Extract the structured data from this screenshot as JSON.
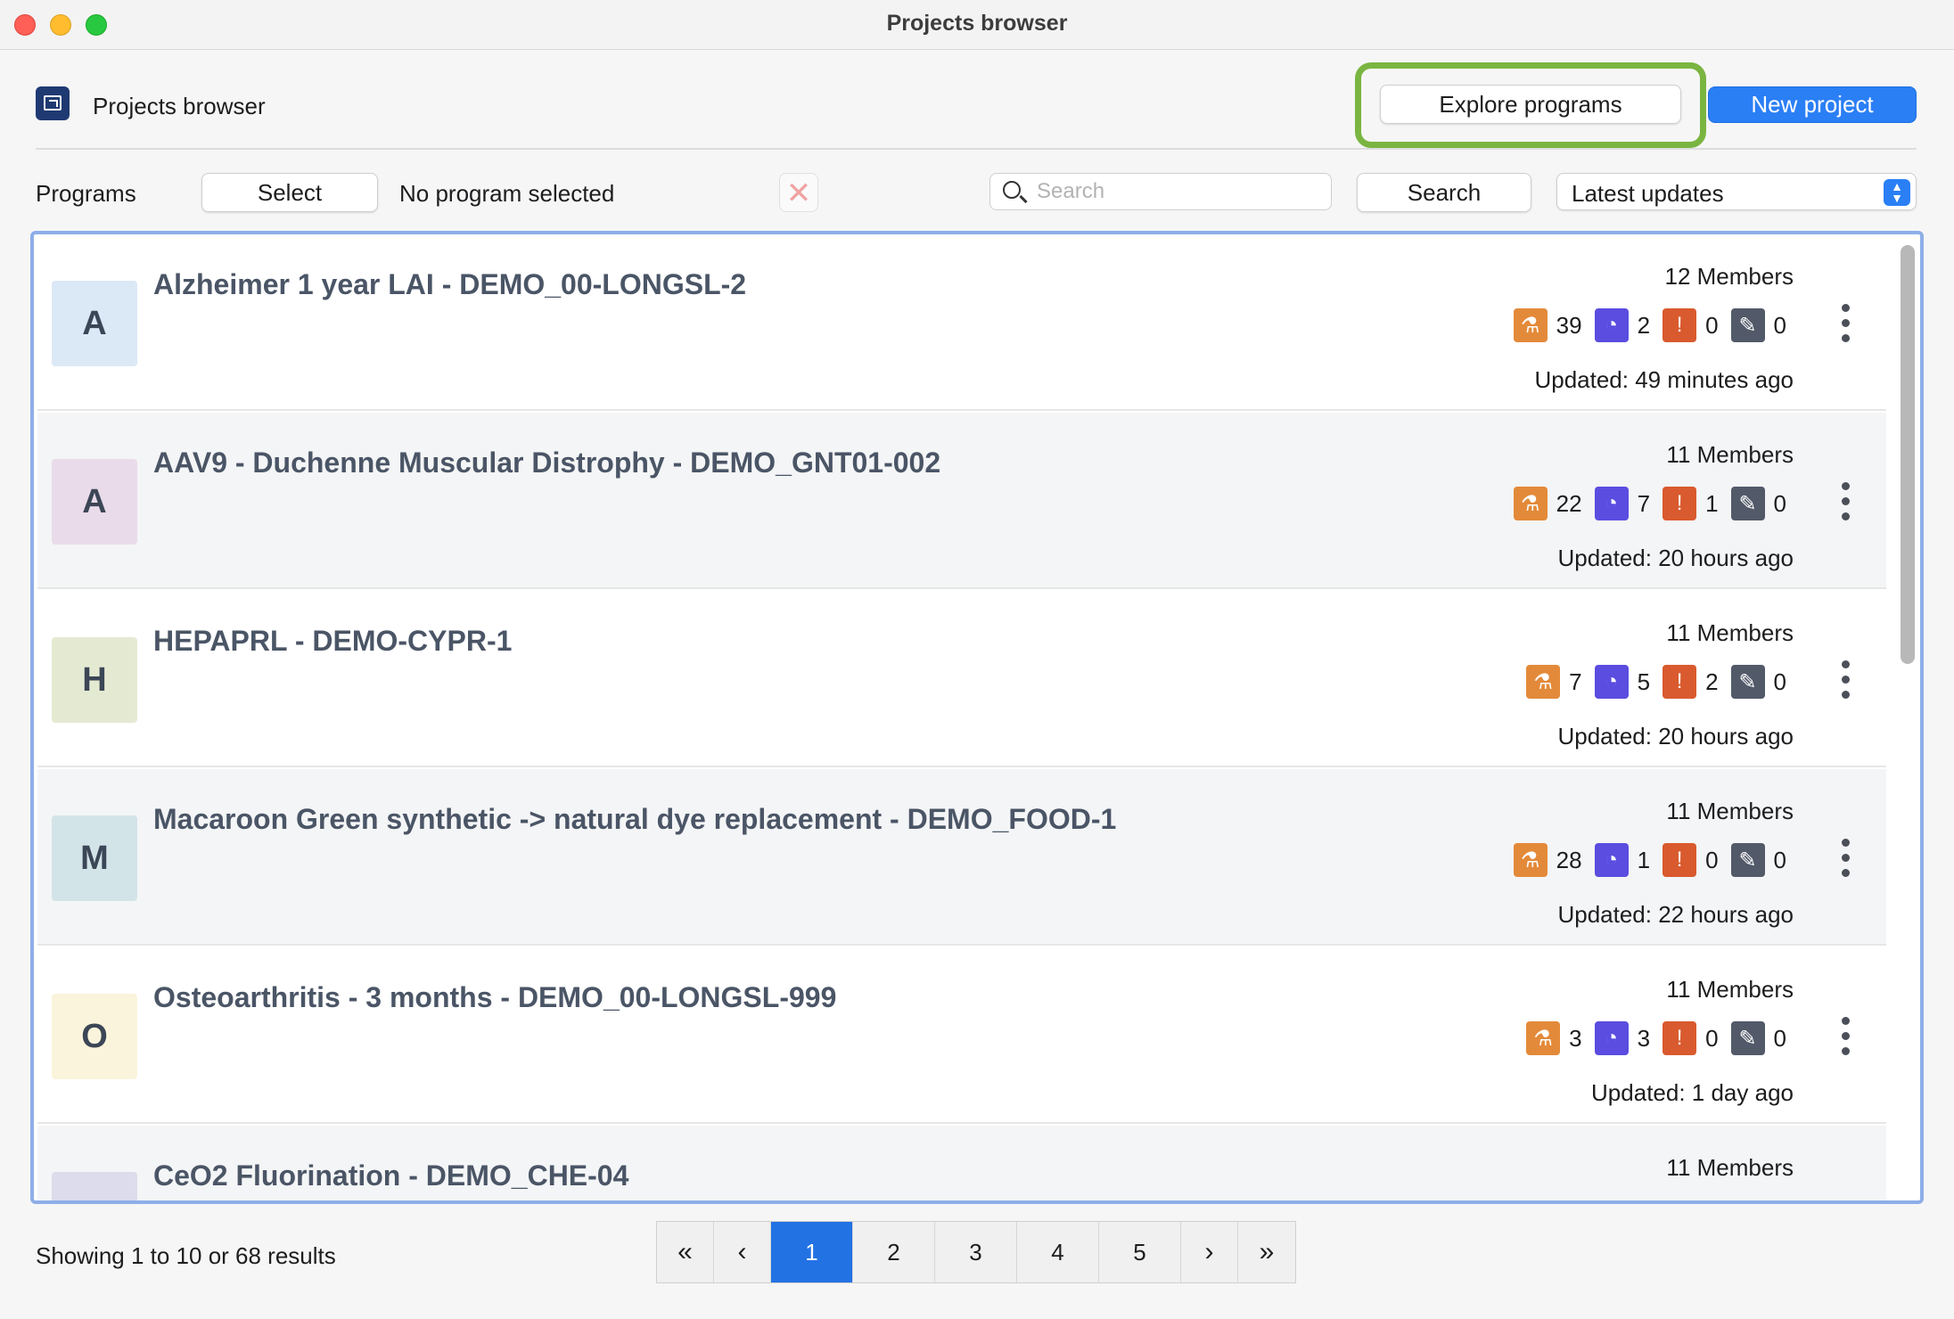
{
  "window": {
    "title": "Projects browser"
  },
  "header": {
    "title": "Projects browser",
    "explore_label": "Explore programs",
    "new_label": "New project"
  },
  "filters": {
    "programs_label": "Programs",
    "select_label": "Select",
    "no_program": "No program selected",
    "clear_icon": "✕",
    "search_placeholder": "Search",
    "search_label": "Search",
    "sort_value": "Latest updates"
  },
  "projects": [
    {
      "initial": "A",
      "avatar_color": "#dbe8f6",
      "title": "Alzheimer 1 year LAI - DEMO_00-LONGSL-2",
      "members": "12 Members",
      "lab": "39",
      "pie": "2",
      "warn": "0",
      "doc": "0",
      "updated": "Updated: 49 minutes ago"
    },
    {
      "initial": "A",
      "avatar_color": "#eadbea",
      "title": "AAV9 - Duchenne Muscular Distrophy - DEMO_GNT01-002",
      "members": "11 Members",
      "lab": "22",
      "pie": "7",
      "warn": "1",
      "doc": "0",
      "updated": "Updated: 20 hours ago"
    },
    {
      "initial": "H",
      "avatar_color": "#e4ead2",
      "title": "HEPAPRL - DEMO-CYPR-1",
      "members": "11 Members",
      "lab": "7",
      "pie": "5",
      "warn": "2",
      "doc": "0",
      "updated": "Updated: 20 hours ago"
    },
    {
      "initial": "M",
      "avatar_color": "#d3e4e8",
      "title": "Macaroon Green synthetic -> natural dye replacement - DEMO_FOOD-1",
      "members": "11 Members",
      "lab": "28",
      "pie": "1",
      "warn": "0",
      "doc": "0",
      "updated": "Updated: 22 hours ago"
    },
    {
      "initial": "O",
      "avatar_color": "#fbf4dc",
      "title": "Osteoarthritis - 3 months - DEMO_00-LONGSL-999",
      "members": "11 Members",
      "lab": "3",
      "pie": "3",
      "warn": "0",
      "doc": "0",
      "updated": "Updated: 1 day ago"
    },
    {
      "initial": "",
      "avatar_color": "#dcdcec",
      "title": "CeO2 Fluorination - DEMO_CHE-04",
      "members": "11 Members"
    }
  ],
  "icons": {
    "lab": "flask-icon",
    "pie": "pie-chart-icon",
    "warn": "alert-clock-icon",
    "doc": "edit-document-icon"
  },
  "footer": {
    "showing": "Showing 1 to 10 or 68 results",
    "pager": {
      "first": "«",
      "prev": "‹",
      "pages": [
        "1",
        "2",
        "3",
        "4",
        "5"
      ],
      "next": "›",
      "last": "»"
    }
  },
  "colors": {
    "accent": "#2a7ff5",
    "highlight": "#7ab541",
    "active_page": "#2272e4"
  }
}
